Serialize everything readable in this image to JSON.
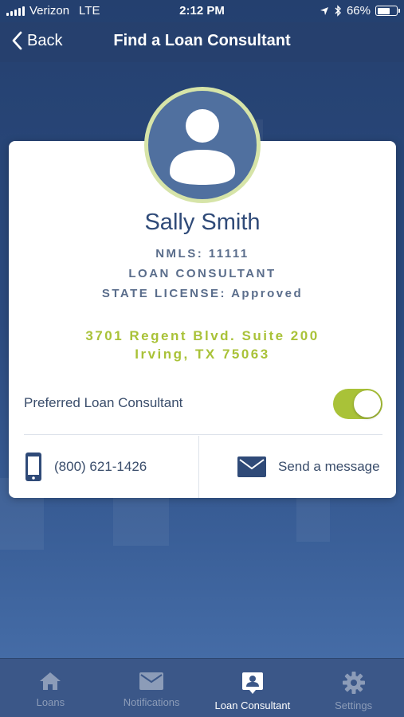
{
  "status_bar": {
    "carrier": "Verizon",
    "network": "LTE",
    "time": "2:12 PM",
    "battery": "66%",
    "battery_level": 0.66
  },
  "nav": {
    "back_label": "Back",
    "title": "Find a Loan Consultant"
  },
  "consultant": {
    "name": "Sally Smith",
    "nmls": "NMLS: 11111",
    "role": "LOAN CONSULTANT",
    "license": "STATE LICENSE: Approved",
    "address_line1": "3701 Regent Blvd. Suite 200",
    "address_line2": "Irving, TX 75063"
  },
  "preferred": {
    "label": "Preferred Loan Consultant",
    "enabled": true
  },
  "actions": {
    "phone": "(800) 621-1426",
    "message": "Send a message"
  },
  "tabs": [
    {
      "label": "Loans",
      "icon": "home-icon",
      "active": false
    },
    {
      "label": "Notifications",
      "icon": "envelope-icon",
      "active": false
    },
    {
      "label": "Loan Consultant",
      "icon": "contact-card-icon",
      "active": true
    },
    {
      "label": "Settings",
      "icon": "gear-icon",
      "active": false
    }
  ],
  "colors": {
    "accent_green": "#a9c238",
    "navy": "#2f4a78",
    "background": "#2c4b7f"
  }
}
